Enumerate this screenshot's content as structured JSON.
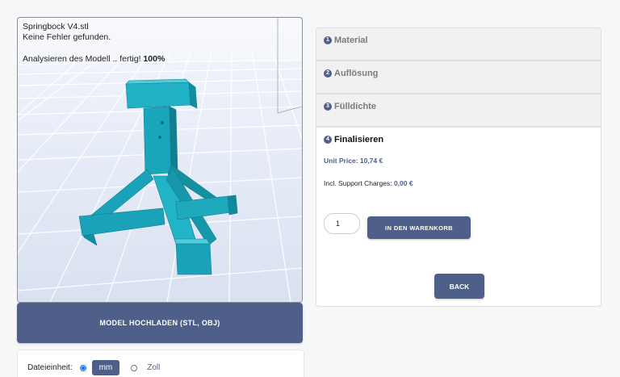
{
  "viewer": {
    "filename": "Springbock V4.stl",
    "status": "Keine Fehler gefunden.",
    "analysis_text": "Analysieren des Modell .. fertig!",
    "analysis_percent": "100%",
    "model_color": "#1aa3b8"
  },
  "upload": {
    "label": "MODEL HOCHLADEN (STL, OBJ)"
  },
  "units": {
    "label": "Dateieinheit:",
    "options": [
      {
        "label": "mm",
        "selected": true
      },
      {
        "label": "Zoll",
        "selected": false
      }
    ]
  },
  "steps": [
    {
      "number": "1",
      "title": "Material"
    },
    {
      "number": "2",
      "title": "Auflösung"
    },
    {
      "number": "3",
      "title": "Fülldichte"
    },
    {
      "number": "4",
      "title": "Finalisieren"
    }
  ],
  "finalize": {
    "unit_price": "Unit Price: 10,74 €",
    "support_label": "Incl. Support Charges:",
    "support_value": "0,00 €",
    "quantity": "1",
    "add_to_cart": "IN DEN WARENKORB",
    "back": "BACK"
  },
  "colors": {
    "accent": "#4e5f8a",
    "radio_selected": "#1a73e8"
  }
}
